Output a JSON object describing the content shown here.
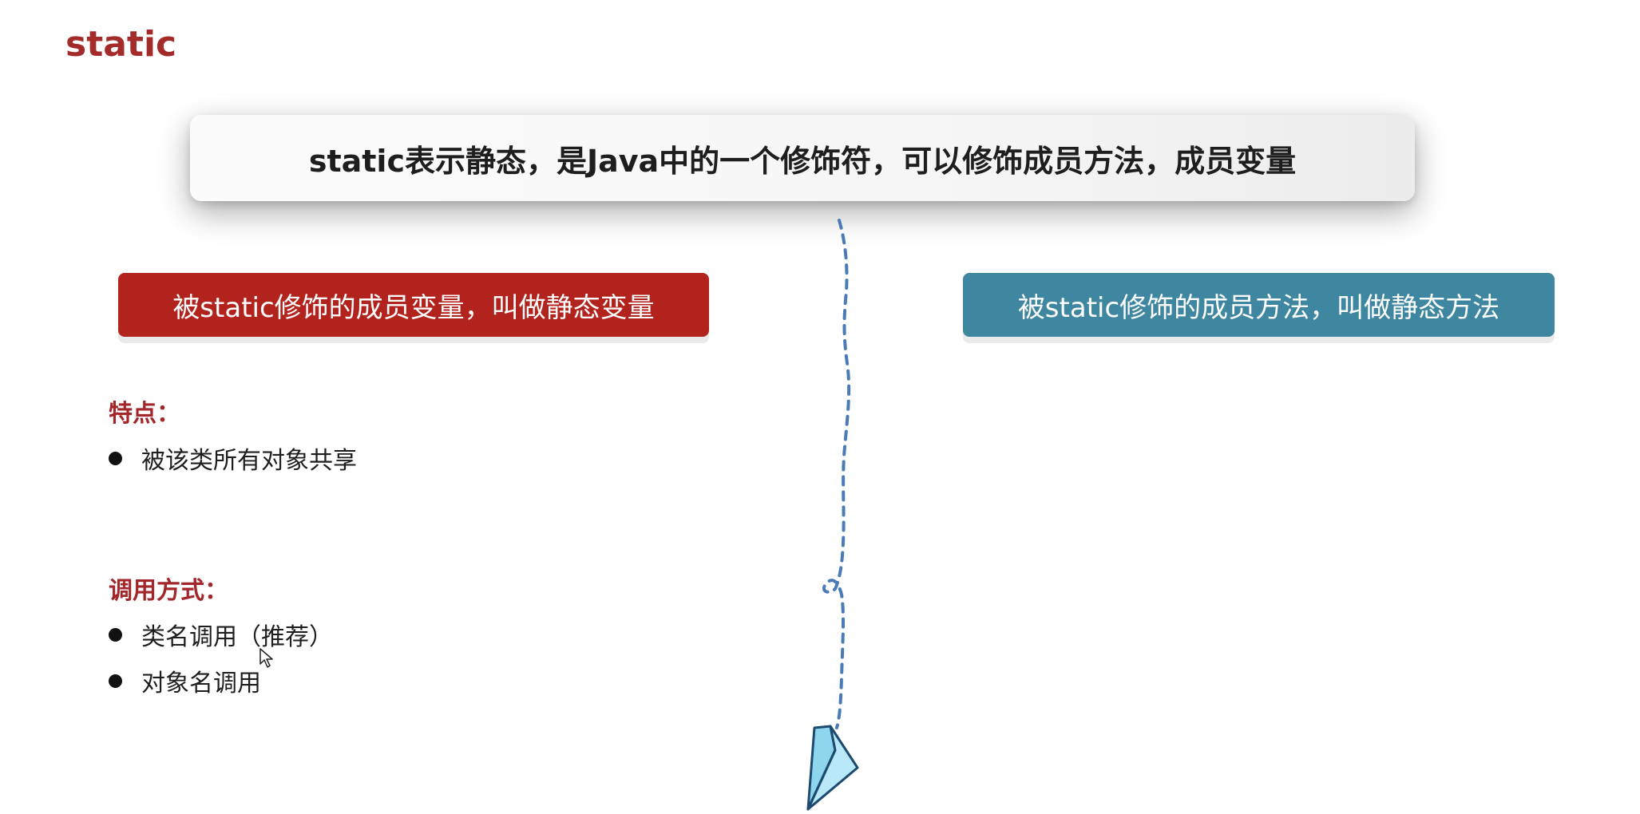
{
  "slide": {
    "title": "static",
    "banner_text": "static表示静态，是Java中的一个修饰符，可以修饰成员方法，成员变量",
    "left_box_label": "被static修饰的成员变量，叫做静态变量",
    "right_box_label": "被static修饰的成员方法，叫做静态方法",
    "features": {
      "heading": "特点：",
      "items": [
        "被该类所有对象共享"
      ]
    },
    "call_methods": {
      "heading": "调用方式：",
      "items": [
        "类名调用（推荐）",
        "对象名调用"
      ]
    }
  },
  "colors": {
    "title_red": "#a32b2a",
    "left_box": "#b3231d",
    "right_box": "#3f87a0",
    "heading_red": "#a3262a",
    "dashed_line": "#4a7bb7"
  },
  "icons": {
    "plane": "paper-plane-icon",
    "cursor": "mouse-cursor-icon"
  }
}
